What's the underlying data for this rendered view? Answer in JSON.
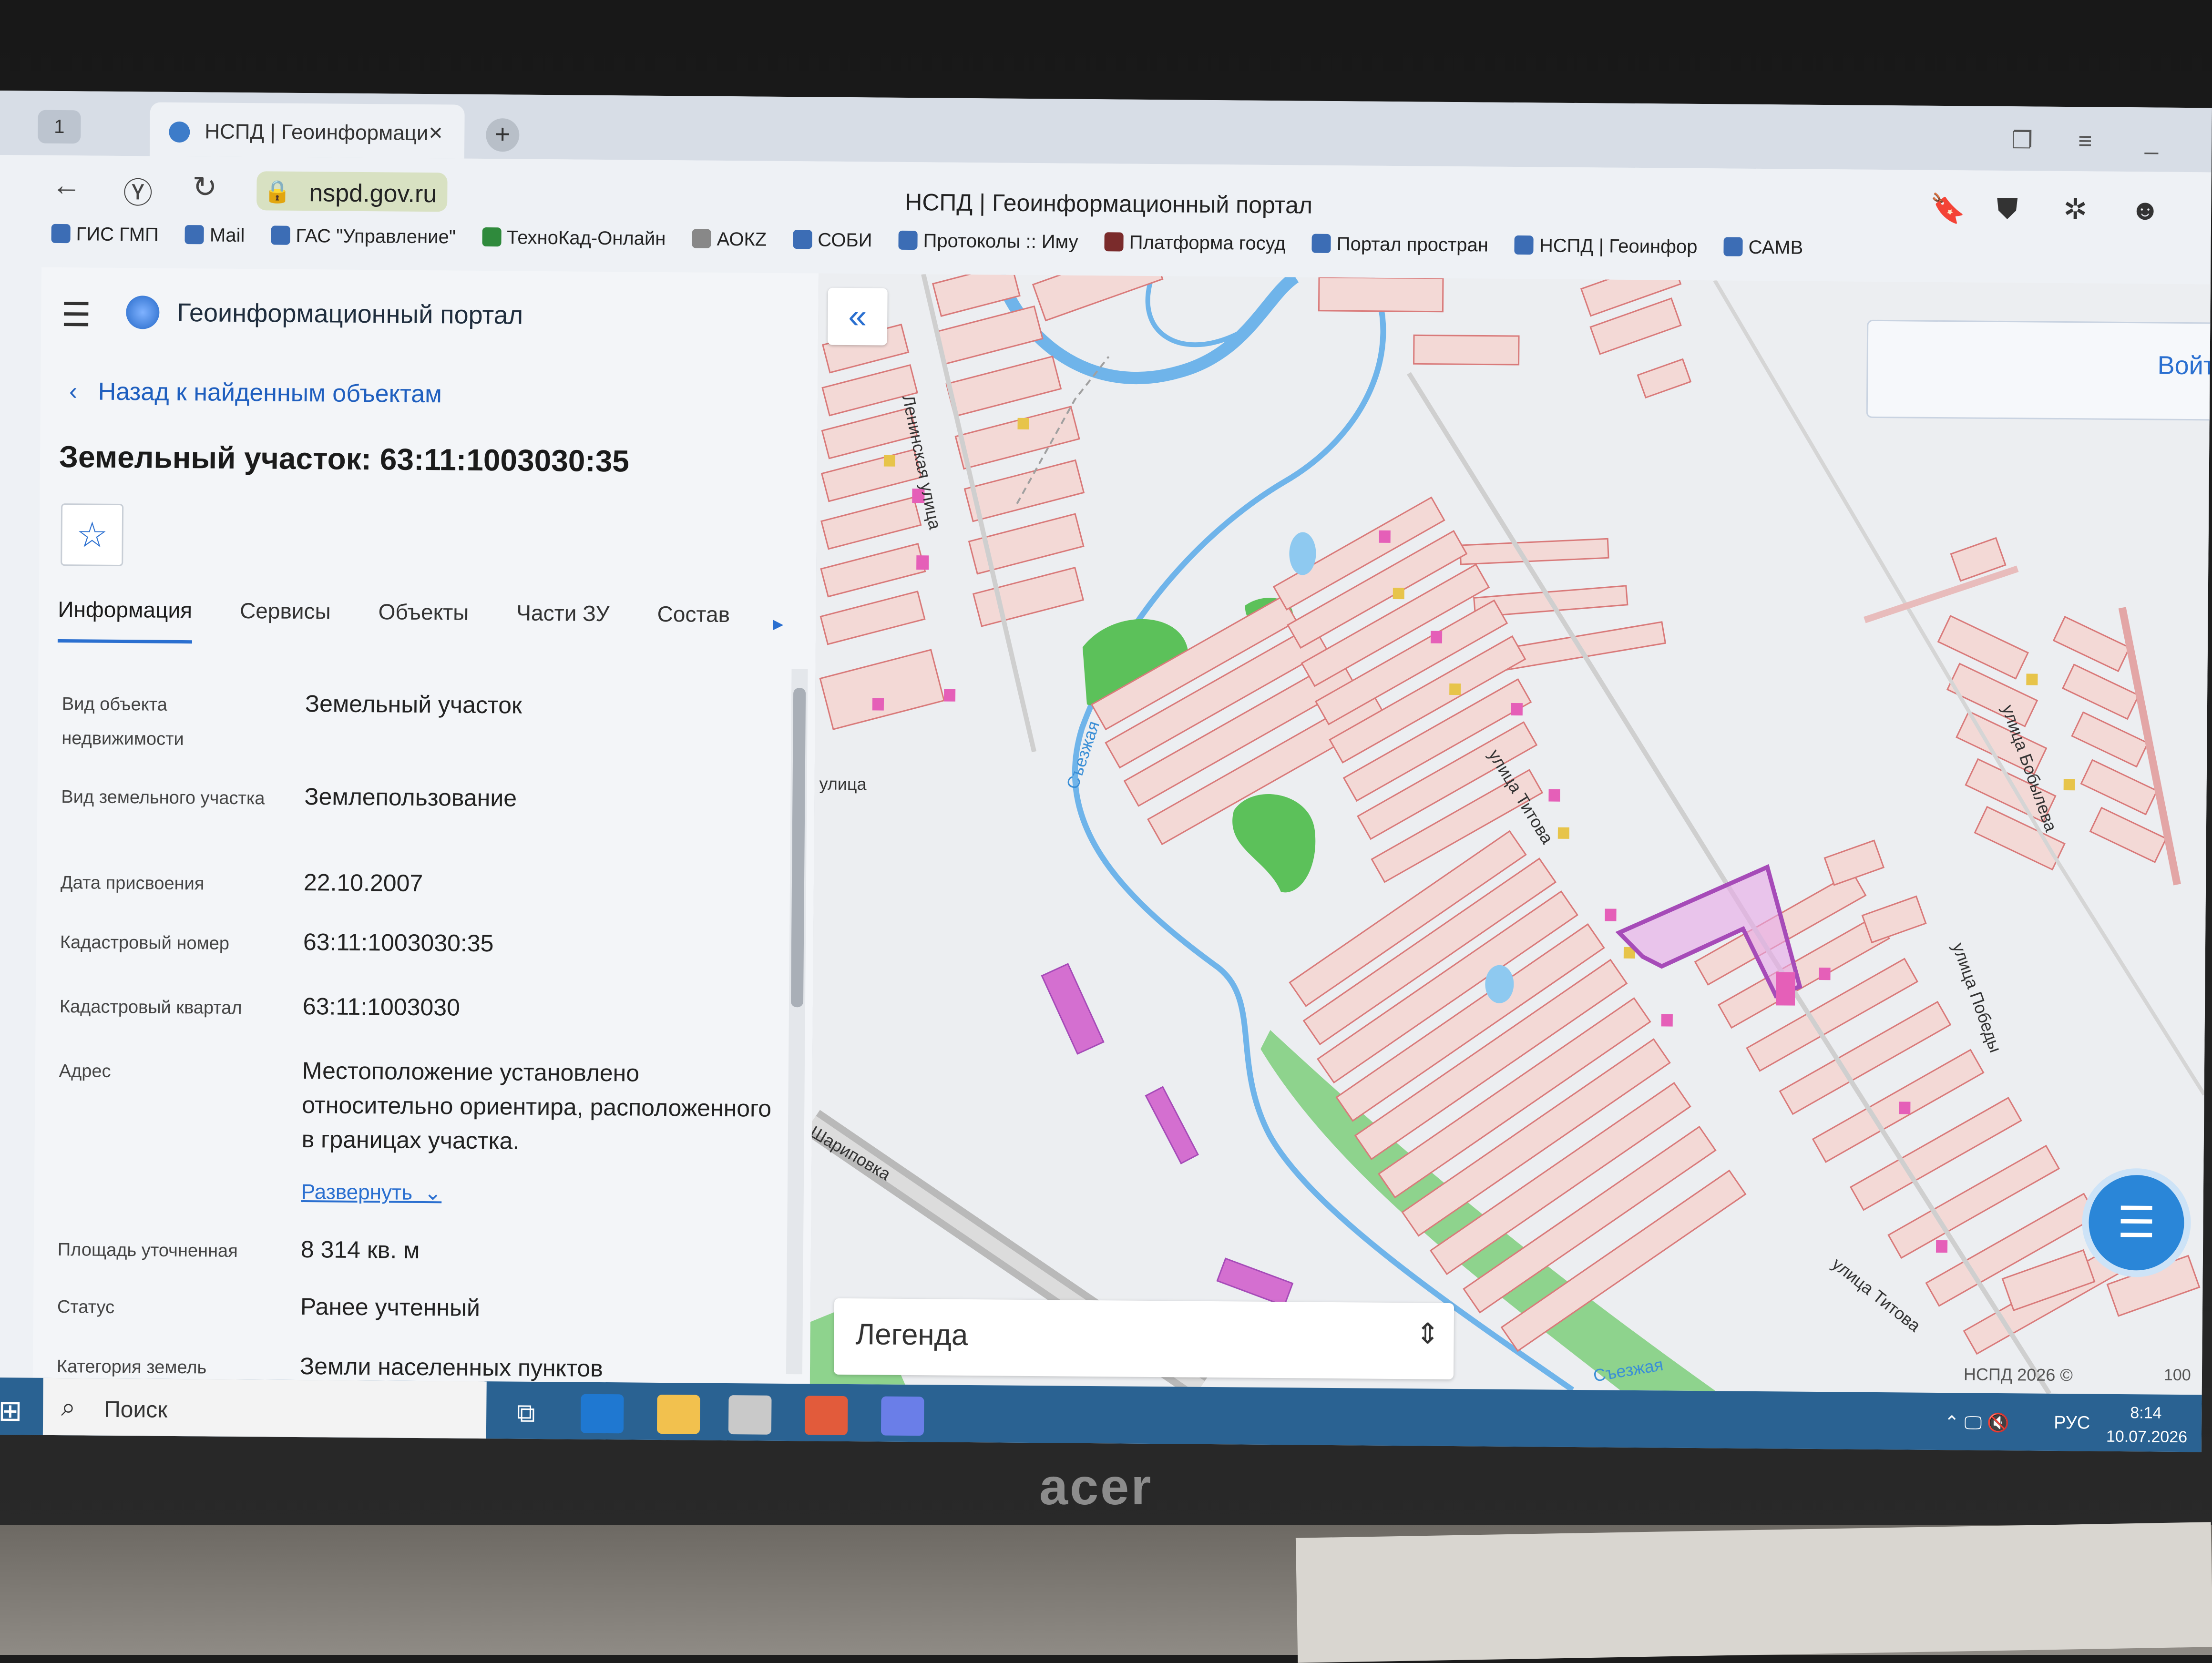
{
  "browser": {
    "tab_count": "1",
    "tab_title": "НСПД | Геоинформаци",
    "tab_close": "×",
    "new_tab": "+",
    "url": "nspd.gov.ru",
    "window_title": "НСПД | Геоинформационный портал",
    "bookmarks": [
      "ГИС ГМП",
      "Mail",
      "ГАС \"Управление\"",
      "ТехноКад-Онлайн",
      "АОКZ",
      "СОБИ",
      "Протоколы :: Иму",
      "Платформа госуд",
      "Портал простран",
      "НСПД | Геоинфор",
      "САМВ"
    ]
  },
  "portal": {
    "title": "Геоинформационный портал",
    "back_link": "Назад к найденным объектам",
    "object_title": "Земельный участок: 63:11:1003030:35",
    "tabs": [
      "Информация",
      "Сервисы",
      "Объекты",
      "Части ЗУ",
      "Состав"
    ],
    "active_tab": 0,
    "fields": [
      {
        "label": "Вид объекта недвижимости",
        "value": "Земельный участок"
      },
      {
        "label": "Вид земельного участка",
        "value": "Землепользование"
      },
      {
        "label": "Дата присвоения",
        "value": "22.10.2007"
      },
      {
        "label": "Кадастровый номер",
        "value": "63:11:1003030:35"
      },
      {
        "label": "Кадастровый квартал",
        "value": "63:11:1003030"
      },
      {
        "label": "Адрес",
        "value": "Местоположение установлено относительно ориентира, расположенного в границах участка."
      },
      {
        "label": "Площадь уточненная",
        "value": "8 314 кв. м"
      },
      {
        "label": "Статус",
        "value": "Ранее учтенный"
      },
      {
        "label": "Категория земель",
        "value": "Земли населенных пунктов"
      }
    ],
    "expand_label": "Развернуть"
  },
  "map": {
    "login": "Войт",
    "legend": "Легенда",
    "copyright": "НСПД 2026 ©",
    "scale": "100",
    "streets": {
      "lenin": "Ленинская улица",
      "titova1": "улица Титова",
      "titova2": "улица Титова",
      "bobyleva": "улица Бобылева",
      "pobedy": "улица Победы",
      "sezzhaya": "Съезжая",
      "sezzhaya2": "Съезжая",
      "ulitsa": "улица",
      "sharipovka": "Шариповка"
    }
  },
  "taskbar": {
    "search": "Поиск",
    "lang": "РУС",
    "time": "8:14",
    "date": "10.07.2026"
  },
  "monitor": {
    "brand": "acer"
  },
  "colors": {
    "accent": "#2a6fd0",
    "highlight_parcel": "#a64bb8",
    "parcel_fill": "#f3d9d6",
    "water": "#4aa3e8",
    "green": "#5cc15a"
  }
}
